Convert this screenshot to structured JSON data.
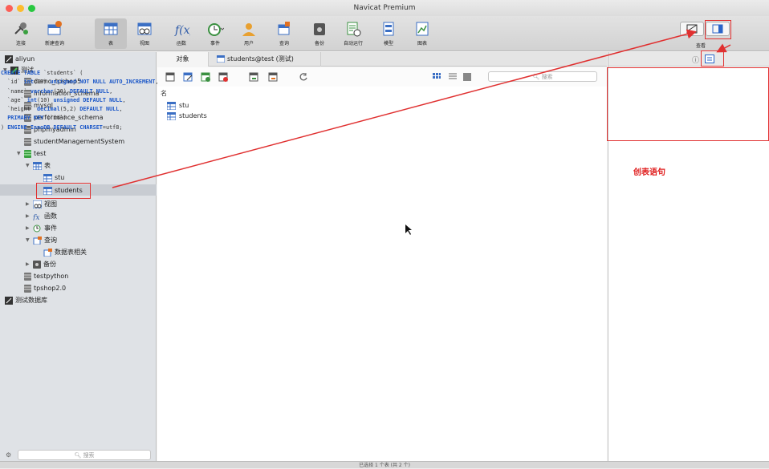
{
  "window": {
    "title": "Navicat Premium"
  },
  "toolbar": {
    "items": [
      {
        "label": "连接",
        "icon": "connection-icon"
      },
      {
        "label": "新建查询",
        "icon": "new-query-icon"
      },
      {
        "label": "表",
        "icon": "table-icon"
      },
      {
        "label": "视图",
        "icon": "view-icon"
      },
      {
        "label": "函数",
        "icon": "function-icon"
      },
      {
        "label": "事件",
        "icon": "event-icon"
      },
      {
        "label": "用户",
        "icon": "user-icon"
      },
      {
        "label": "查询",
        "icon": "query-icon"
      },
      {
        "label": "备份",
        "icon": "backup-icon"
      },
      {
        "label": "自动运行",
        "icon": "schedule-icon"
      },
      {
        "label": "模型",
        "icon": "model-icon"
      },
      {
        "label": "图表",
        "icon": "chart-icon"
      }
    ],
    "view_label": "查看"
  },
  "sidebar": {
    "tree": [
      {
        "label": "aliyun"
      },
      {
        "label": "测试"
      },
      {
        "label": "demo_tpshop5"
      },
      {
        "label": "information_schema"
      },
      {
        "label": "mysql"
      },
      {
        "label": "performance_schema"
      },
      {
        "label": "phpmyadmin"
      },
      {
        "label": "studentManagementSystem"
      },
      {
        "label": "test"
      },
      {
        "label": "表"
      },
      {
        "label": "stu"
      },
      {
        "label": "students"
      },
      {
        "label": "视图"
      },
      {
        "label": "函数"
      },
      {
        "label": "事件"
      },
      {
        "label": "查询"
      },
      {
        "label": "数据表相关"
      },
      {
        "label": "备份"
      },
      {
        "label": "testpython"
      },
      {
        "label": "tpshop2.0"
      },
      {
        "label": "测试数据库"
      }
    ],
    "search_placeholder": "搜索"
  },
  "tabs": [
    {
      "label": "对象"
    },
    {
      "label": "students@test (测试)"
    }
  ],
  "objects": {
    "search_placeholder": "搜索",
    "column_header": "名",
    "items": [
      {
        "name": "stu"
      },
      {
        "name": "students"
      }
    ]
  },
  "ddl": {
    "lines": [
      "CREATE TABLE `students` (",
      "  `id` int(10) unsigned NOT NULL AUTO_INCREMENT,",
      "  `name` varchar(20) DEFAULT NULL,",
      "  `age` int(10) unsigned DEFAULT NULL,",
      "  `height` decimal(5,2) DEFAULT NULL,",
      "  PRIMARY KEY (`id`)",
      ") ENGINE=InnoDB DEFAULT CHARSET=utf8;"
    ]
  },
  "annotation": {
    "text": "创表语句"
  },
  "statusbar": {
    "text": "已选择 1 个表 (共 2 个)"
  },
  "colors": {
    "accent": "#1b57c8",
    "annotation": "#e02020",
    "sidebar_bg": "#dfe2e6"
  }
}
